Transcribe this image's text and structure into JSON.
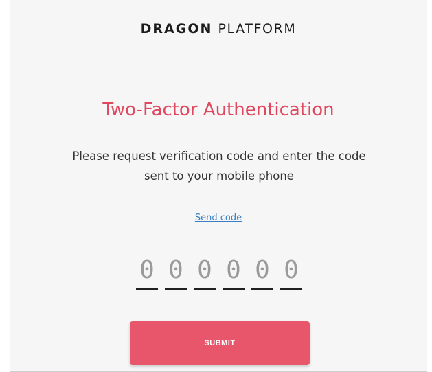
{
  "brand": {
    "strong": "DRAGON",
    "light": "PLATFORM"
  },
  "title": "Two-Factor Authentication",
  "description": {
    "line1": "Please request verification code and enter the code",
    "line2": "sent to your mobile phone"
  },
  "send_code_label": "Send code",
  "code_inputs": [
    {
      "placeholder": "0",
      "value": ""
    },
    {
      "placeholder": "0",
      "value": ""
    },
    {
      "placeholder": "0",
      "value": ""
    },
    {
      "placeholder": "0",
      "value": ""
    },
    {
      "placeholder": "0",
      "value": ""
    },
    {
      "placeholder": "0",
      "value": ""
    }
  ],
  "submit_label": "SUBMIT",
  "colors": {
    "accent": "#e0485f",
    "button": "#e8566c",
    "link": "#3a7fc4",
    "background": "#f6f6f6"
  }
}
